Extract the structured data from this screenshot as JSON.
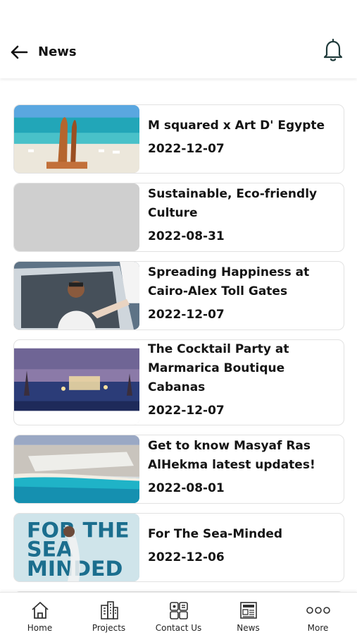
{
  "header": {
    "title": "News",
    "back_icon": "arrow-left-icon",
    "notification_icon": "bell-icon"
  },
  "news": [
    {
      "title": "M squared x Art D' Egypte",
      "date": "2022-12-07"
    },
    {
      "title": "Sustainable, Eco-friendly Culture",
      "date": "2022-08-31"
    },
    {
      "title": "Spreading Happiness at Cairo-Alex Toll Gates",
      "date": "2022-12-07"
    },
    {
      "title": "The Cocktail Party at Marmarica Boutique Cabanas",
      "date": "2022-12-07"
    },
    {
      "title": "Get to know Masyaf Ras AlHekma latest updates!",
      "date": "2022-08-01"
    },
    {
      "title": "For The Sea-Minded",
      "date": "2022-12-06"
    }
  ],
  "thumb_text": {
    "sea_minded": [
      "FOR THE",
      "SEA",
      "MINDED"
    ]
  },
  "bottom_nav": [
    {
      "label": "Home",
      "icon": "home-icon"
    },
    {
      "label": "Projects",
      "icon": "buildings-icon"
    },
    {
      "label": "Contact Us",
      "icon": "contact-icon"
    },
    {
      "label": "News",
      "icon": "newspaper-icon"
    },
    {
      "label": "More",
      "icon": "more-dots-icon"
    }
  ],
  "colors": {
    "text": "#141414",
    "card_border": "#e2e2e2",
    "placeholder": "#cfcfcf",
    "sea": "#1f9bb8"
  }
}
